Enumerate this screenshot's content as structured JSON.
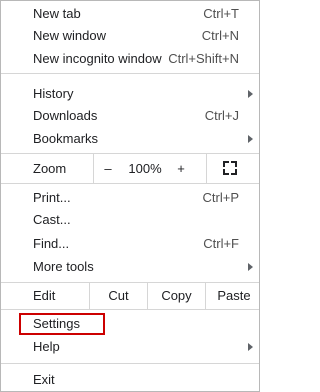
{
  "menu": {
    "new_tab": {
      "label": "New tab",
      "shortcut": "Ctrl+T"
    },
    "new_window": {
      "label": "New window",
      "shortcut": "Ctrl+N"
    },
    "new_incognito": {
      "label": "New incognito window",
      "shortcut": "Ctrl+Shift+N"
    },
    "history": {
      "label": "History"
    },
    "downloads": {
      "label": "Downloads",
      "shortcut": "Ctrl+J"
    },
    "bookmarks": {
      "label": "Bookmarks"
    },
    "zoom": {
      "label": "Zoom",
      "minus": "–",
      "level": "100%",
      "plus": "+",
      "fullscreen_icon": "fullscreen-icon"
    },
    "print": {
      "label": "Print...",
      "shortcut": "Ctrl+P"
    },
    "cast": {
      "label": "Cast..."
    },
    "find": {
      "label": "Find...",
      "shortcut": "Ctrl+F"
    },
    "more_tools": {
      "label": "More tools"
    },
    "edit": {
      "label": "Edit",
      "cut": "Cut",
      "copy": "Copy",
      "paste": "Paste"
    },
    "settings": {
      "label": "Settings"
    },
    "help": {
      "label": "Help"
    },
    "exit": {
      "label": "Exit"
    }
  },
  "colors": {
    "highlight_border": "#cc0000",
    "separator": "#d6d6d6",
    "text": "#202124"
  }
}
